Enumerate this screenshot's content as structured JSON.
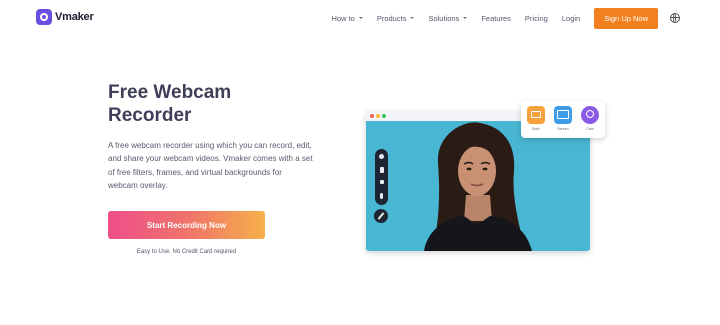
{
  "brand": {
    "name": "Vmaker",
    "logo_icon": "vmaker-logo-icon",
    "color": "#6b4fe0"
  },
  "nav": {
    "items": [
      {
        "label": "How to",
        "dropdown": true
      },
      {
        "label": "Products",
        "dropdown": true
      },
      {
        "label": "Solutions",
        "dropdown": true
      },
      {
        "label": "Features",
        "dropdown": false
      },
      {
        "label": "Pricing",
        "dropdown": false
      },
      {
        "label": "Login",
        "dropdown": false
      }
    ],
    "signup_label": "Sign Up Now",
    "signup_color": "#f2801f",
    "language_icon": "globe-icon"
  },
  "hero": {
    "title": "Free Webcam Recorder",
    "description": "A free webcam recorder using which you can record, edit, and share your webcam videos. Vmaker comes with a set of free filters, frames, and virtual backgrounds for webcam overlay.",
    "cta_label": "Start Recording Now",
    "cta_note": "Easy to Use. No Credit Card required"
  },
  "illustration": {
    "window_dots": [
      "#ef5f5a",
      "#f6bd3b",
      "#3ec05a"
    ],
    "recording_modes": [
      {
        "label": "Both",
        "icon": "screen-and-cam-icon",
        "color": "#f7a23b"
      },
      {
        "label": "Screen",
        "icon": "screen-icon",
        "color": "#3f9de8"
      },
      {
        "label": "Cam",
        "icon": "webcam-icon",
        "color": "#8a5ce6"
      }
    ],
    "controls": [
      "settings-icon",
      "pause-icon",
      "stop-icon",
      "microphone-icon"
    ],
    "draw_icon": "pen-icon"
  }
}
